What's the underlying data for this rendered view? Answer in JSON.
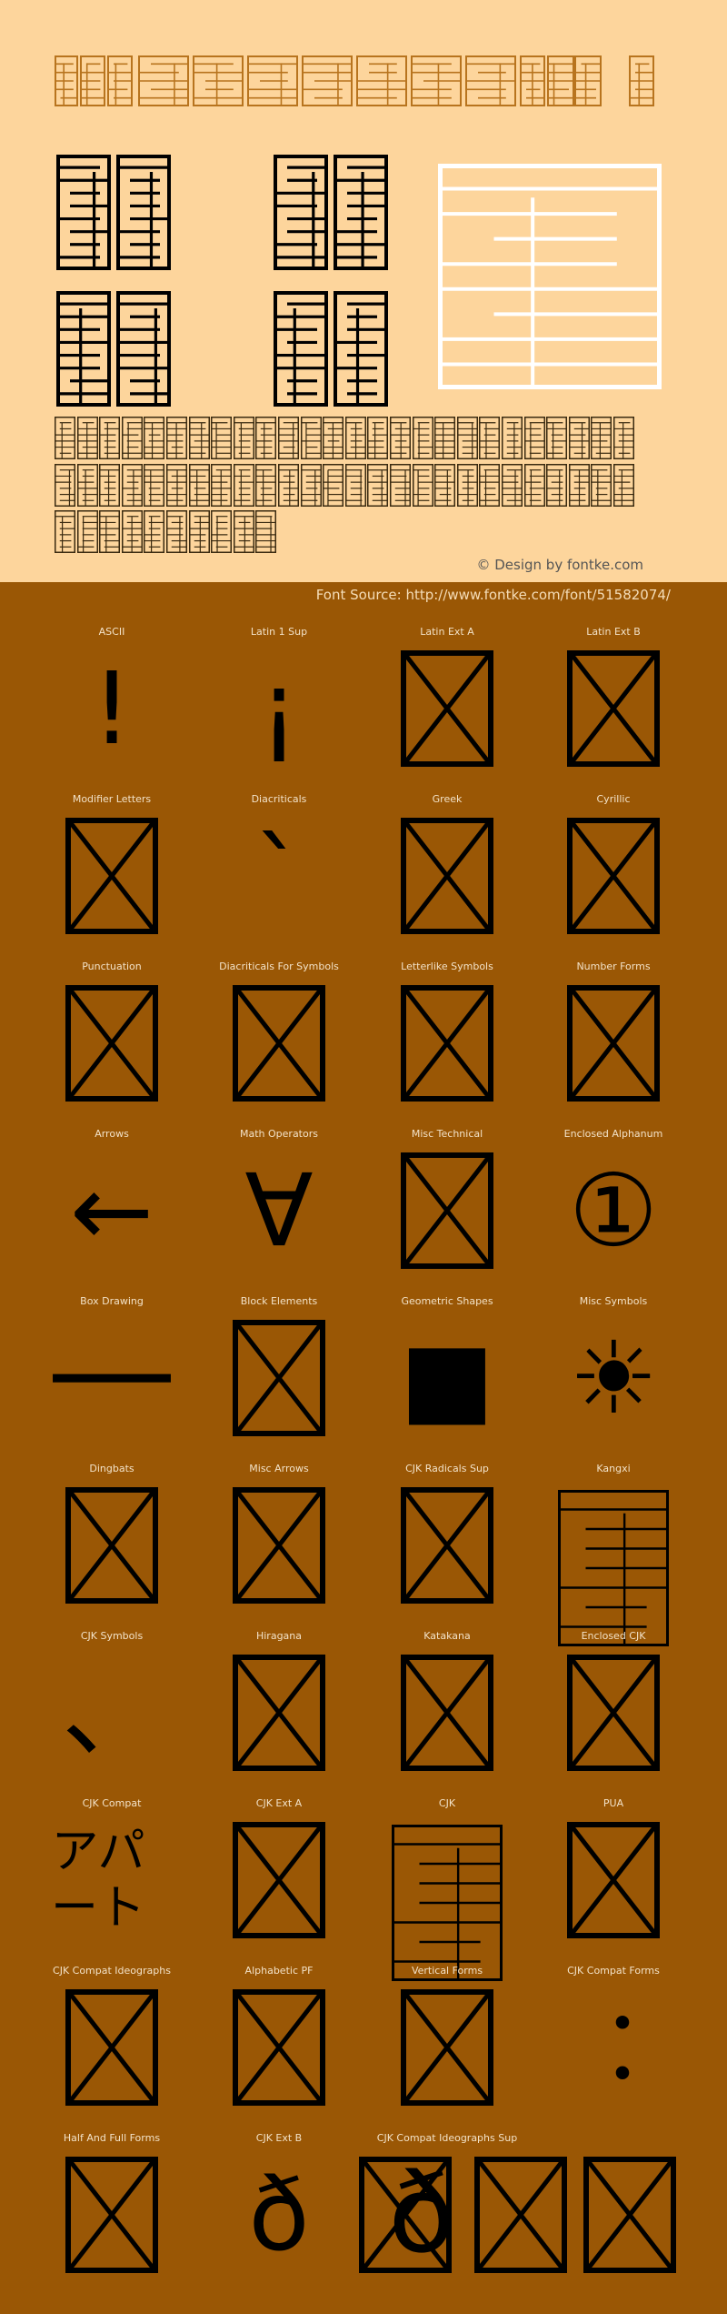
{
  "colors": {
    "preview_bg": "#FDD59C",
    "page_bg": "#9A5705",
    "title_glyph": "#B8741E",
    "glyph": "#000000",
    "white_glyph": "#FFFFFF"
  },
  "credit": "© Design by fontke.com",
  "source": "Font Source: http://www.fontke.com/font/51582074/",
  "blocks": [
    {
      "label": "ASCII",
      "glyph": "char",
      "char": "!"
    },
    {
      "label": "Latin 1 Sup",
      "glyph": "char",
      "char": "¡"
    },
    {
      "label": "Latin Ext A",
      "glyph": "notdef"
    },
    {
      "label": "Latin Ext B",
      "glyph": "notdef"
    },
    {
      "label": "Modifier Letters",
      "glyph": "notdef"
    },
    {
      "label": "Diacriticals",
      "glyph": "char",
      "char": "`"
    },
    {
      "label": "Greek",
      "glyph": "notdef"
    },
    {
      "label": "Cyrillic",
      "glyph": "notdef"
    },
    {
      "label": "Punctuation",
      "glyph": "notdef"
    },
    {
      "label": "Diacriticals For Symbols",
      "glyph": "notdef"
    },
    {
      "label": "Letterlike Symbols",
      "glyph": "notdef"
    },
    {
      "label": "Number Forms",
      "glyph": "notdef"
    },
    {
      "label": "Arrows",
      "glyph": "char",
      "char": "←"
    },
    {
      "label": "Math Operators",
      "glyph": "char",
      "char": "∀"
    },
    {
      "label": "Misc Technical",
      "glyph": "notdef"
    },
    {
      "label": "Enclosed Alphanum",
      "glyph": "char",
      "char": "①"
    },
    {
      "label": "Box Drawing",
      "glyph": "char",
      "char": "─"
    },
    {
      "label": "Block Elements",
      "glyph": "notdef"
    },
    {
      "label": "Geometric Shapes",
      "glyph": "char",
      "char": "■"
    },
    {
      "label": "Misc Symbols",
      "glyph": "char",
      "char": "☀"
    },
    {
      "label": "Dingbats",
      "glyph": "notdef"
    },
    {
      "label": "Misc Arrows",
      "glyph": "notdef"
    },
    {
      "label": "CJK Radicals Sup",
      "glyph": "notdef"
    },
    {
      "label": "Kangxi",
      "glyph": "maze"
    },
    {
      "label": "CJK Symbols",
      "glyph": "char",
      "char": "、"
    },
    {
      "label": "Hiragana",
      "glyph": "notdef"
    },
    {
      "label": "Katakana",
      "glyph": "notdef"
    },
    {
      "label": "Enclosed CJK",
      "glyph": "notdef"
    },
    {
      "label": "CJK Compat",
      "glyph": "char",
      "char": "アパート"
    },
    {
      "label": "CJK Ext A",
      "glyph": "notdef"
    },
    {
      "label": "CJK",
      "glyph": "maze"
    },
    {
      "label": "PUA",
      "glyph": "notdef"
    },
    {
      "label": "CJK Compat Ideographs",
      "glyph": "notdef"
    },
    {
      "label": "Alphabetic PF",
      "glyph": "notdef"
    },
    {
      "label": "Vertical Forms",
      "glyph": "notdef"
    },
    {
      "label": "CJK Compat Forms",
      "glyph": "char",
      "char": "︰"
    },
    {
      "label": "Half And Full Forms",
      "glyph": "notdef"
    },
    {
      "label": "CJK Ext B",
      "glyph": "char",
      "char": "ð"
    },
    {
      "label": "CJK Compat Ideographs Sup",
      "glyph": "overlap",
      "char": "ð"
    }
  ]
}
